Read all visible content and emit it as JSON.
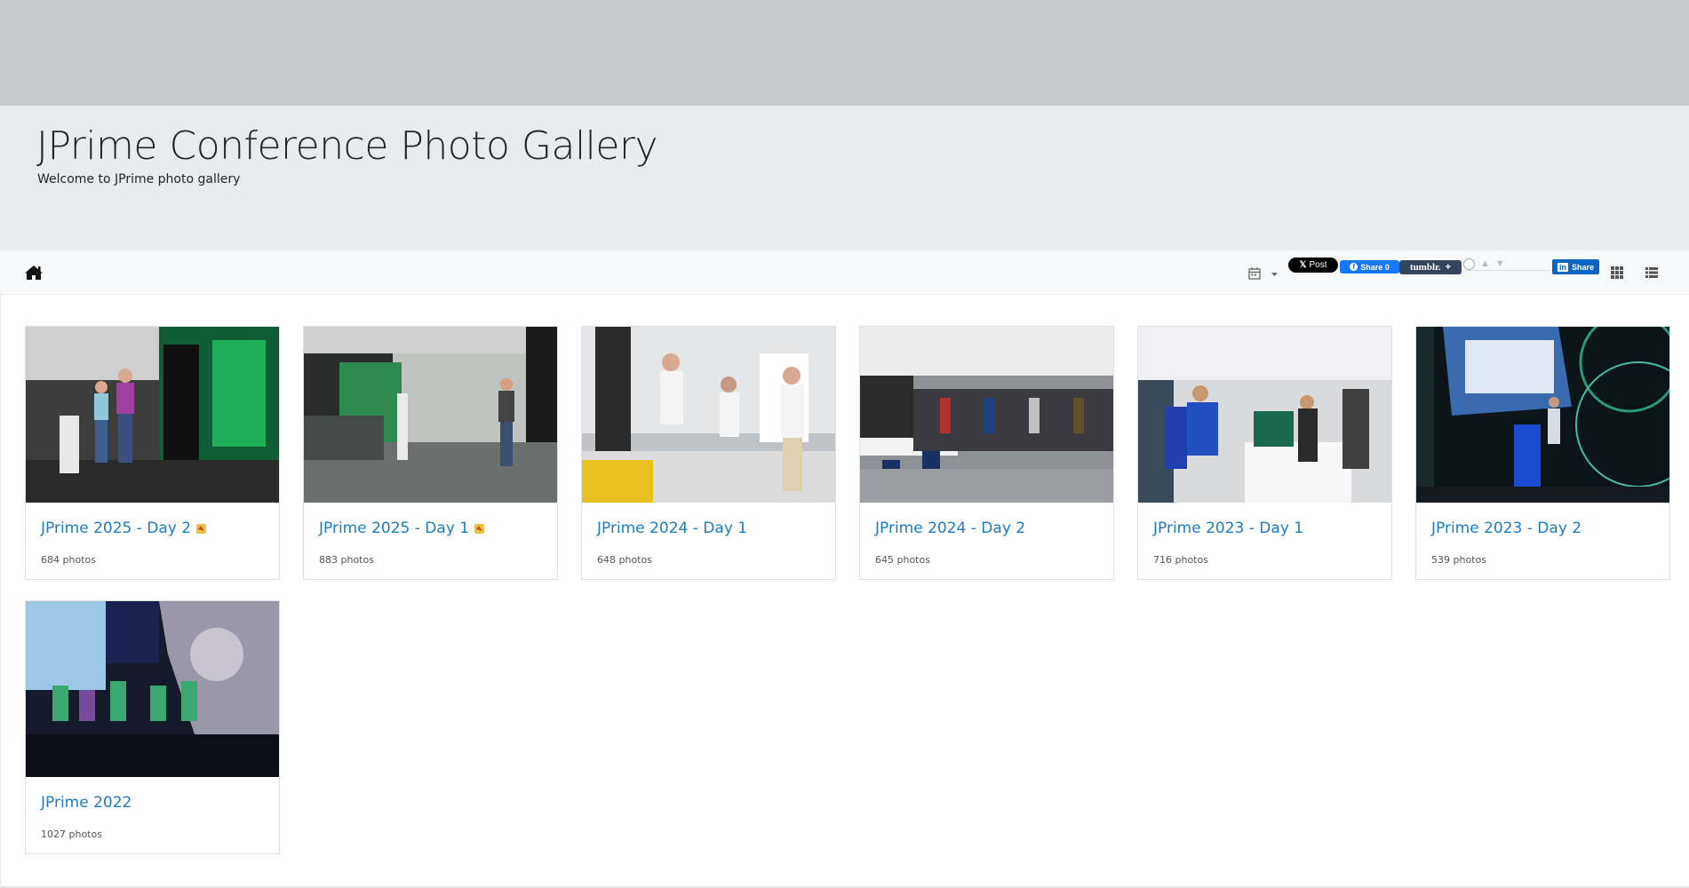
{
  "header": {
    "title": "JPrime Conference Photo Gallery",
    "subtitle": "Welcome to JPrime photo gallery"
  },
  "toolbar": {
    "home_icon": "home-icon",
    "calendar_icon": "calendar-icon",
    "x_post_label": "Post",
    "fb_share_label": "Share 0",
    "tumblr_label": "tumblr.",
    "linkedin_label": "Share",
    "grid_icon": "grid-view-icon",
    "list_icon": "list-view-icon"
  },
  "albums": [
    {
      "title": "JPrime 2025 - Day 2",
      "count": "684 photos",
      "badge": true
    },
    {
      "title": "JPrime 2025 - Day 1",
      "count": "883 photos",
      "badge": true
    },
    {
      "title": "JPrime 2024 - Day 1",
      "count": "648 photos",
      "badge": false
    },
    {
      "title": "JPrime 2024 - Day 2",
      "count": "645 photos",
      "badge": false
    },
    {
      "title": "JPrime 2023 - Day 1",
      "count": "716 photos",
      "badge": false
    },
    {
      "title": "JPrime 2023 - Day 2",
      "count": "539 photos",
      "badge": false
    },
    {
      "title": "JPrime 2022",
      "count": "1027 photos",
      "badge": false
    }
  ],
  "colors": {
    "link": "#1d7cc0",
    "jumbotron": "#e9ecef",
    "top_band": "#c8cbcd"
  }
}
